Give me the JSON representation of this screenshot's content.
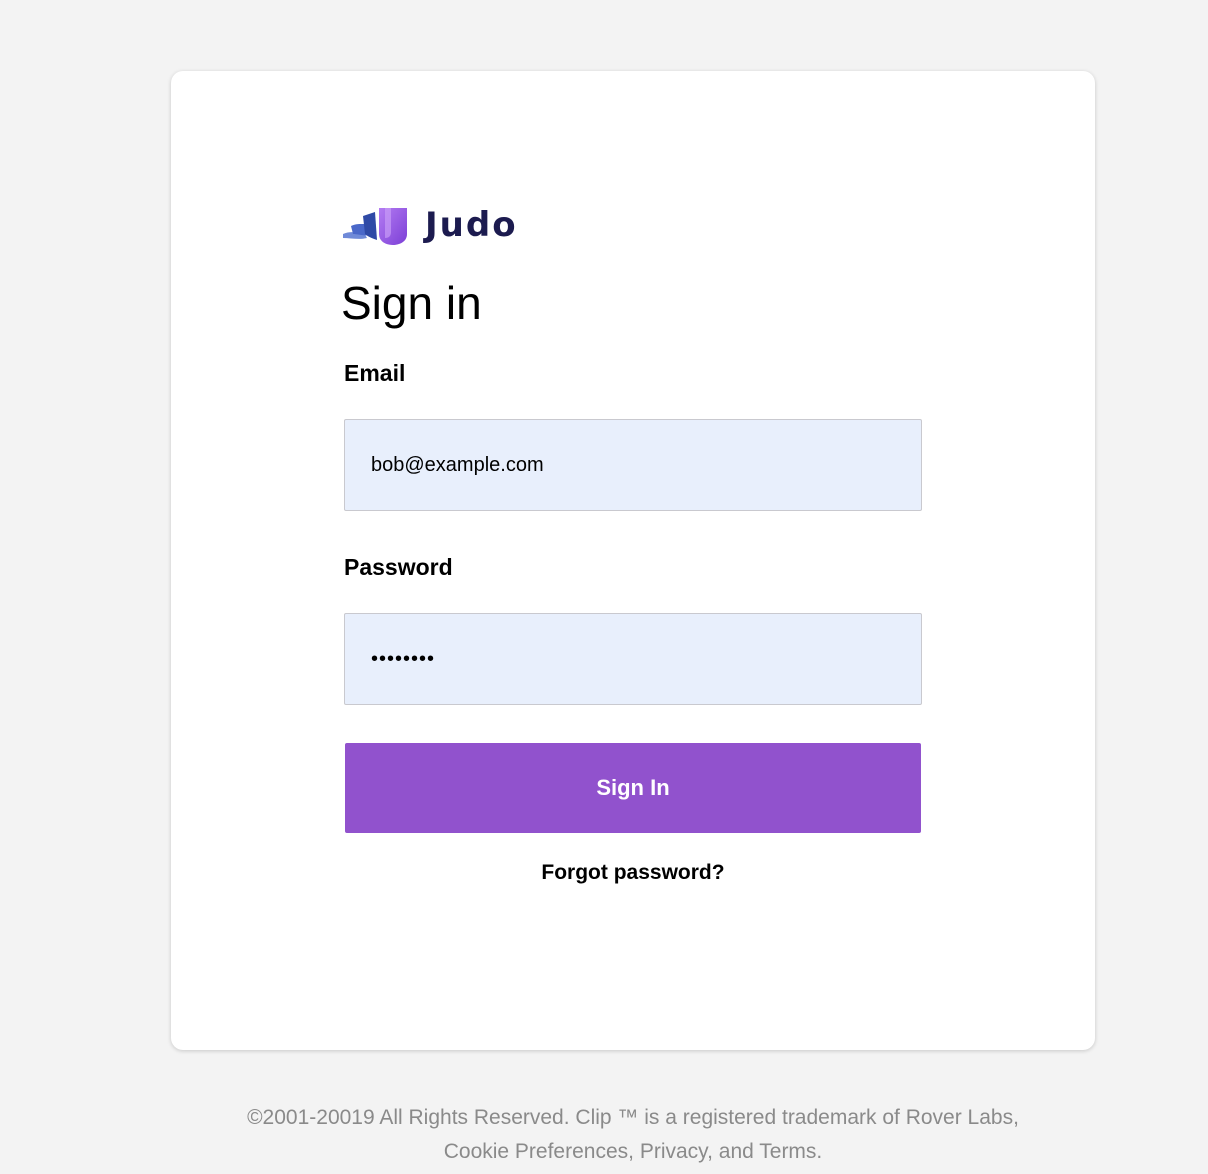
{
  "logo": {
    "text": "Judo",
    "icon": "judo-logo-icon",
    "colors": {
      "text": "#1c1b4f",
      "shield": "#8a4fe0",
      "swoosh": "#4a68c9"
    }
  },
  "form": {
    "title": "Sign in",
    "email": {
      "label": "Email",
      "value": "bob@example.com"
    },
    "password": {
      "label": "Password",
      "value": "••••••••"
    },
    "submit_label": "Sign In",
    "forgot_label": "Forgot password?"
  },
  "footer": {
    "line1": "©2001-20019 All Rights Reserved. Clip ™ is a registered trademark of Rover Labs,",
    "line2": "Cookie Preferences, Privacy, and Terms."
  },
  "colors": {
    "background": "#f3f3f3",
    "card": "#ffffff",
    "input_bg": "#e8effc",
    "button": "#9152cd",
    "footer_text": "#8a8a8a"
  }
}
